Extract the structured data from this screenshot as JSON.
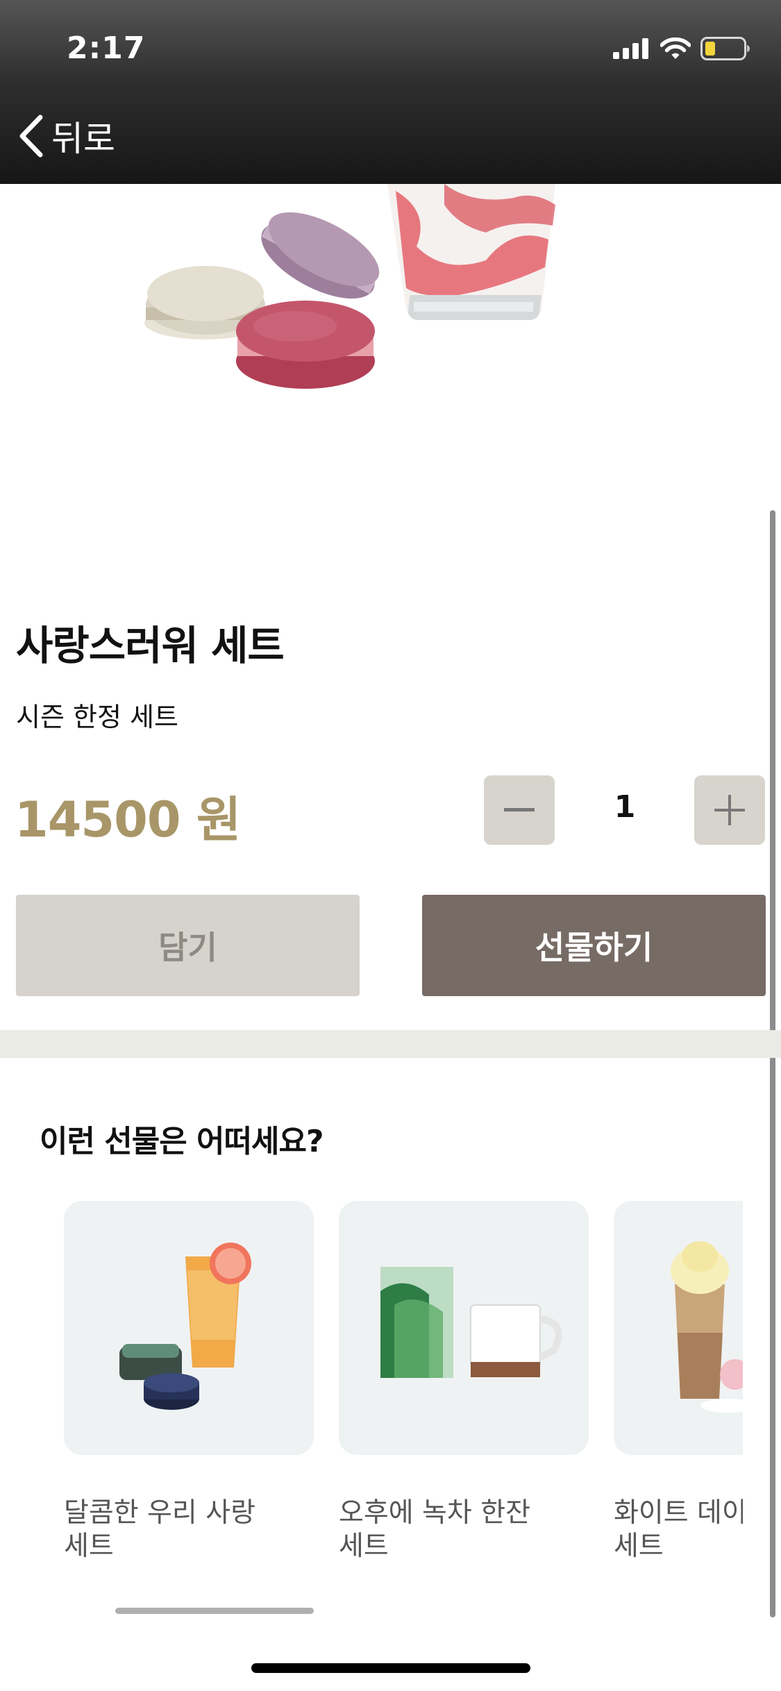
{
  "status_bar": {
    "time": "2:17",
    "icons": [
      "signal-icon",
      "wifi-icon",
      "battery-icon"
    ],
    "battery_color": "#f2d53c"
  },
  "nav": {
    "back_label": "뒤로"
  },
  "hero": {
    "image": "macaron-and-strawberry-frappuccino-photo"
  },
  "product": {
    "title": "사랑스러워 세트",
    "subtitle": "시즌 한정 세트",
    "price": "14500 원",
    "quantity": "1",
    "price_color": "#a89668"
  },
  "actions": {
    "cart_label": "담기",
    "gift_label": "선물하기",
    "gift_color": "#776b66"
  },
  "recommendations": {
    "heading": "이런 선물은 어떠세요?",
    "items": [
      {
        "label": "달콤한 우리 사랑\n세트",
        "image": "grapefruit-drink-and-candy-tins"
      },
      {
        "label": "오후에 녹차 한잔\n세트",
        "image": "green-tea-box-and-mug"
      },
      {
        "label": "화이트 데이\n세트",
        "image": "cream-latte-and-macarons"
      }
    ]
  }
}
